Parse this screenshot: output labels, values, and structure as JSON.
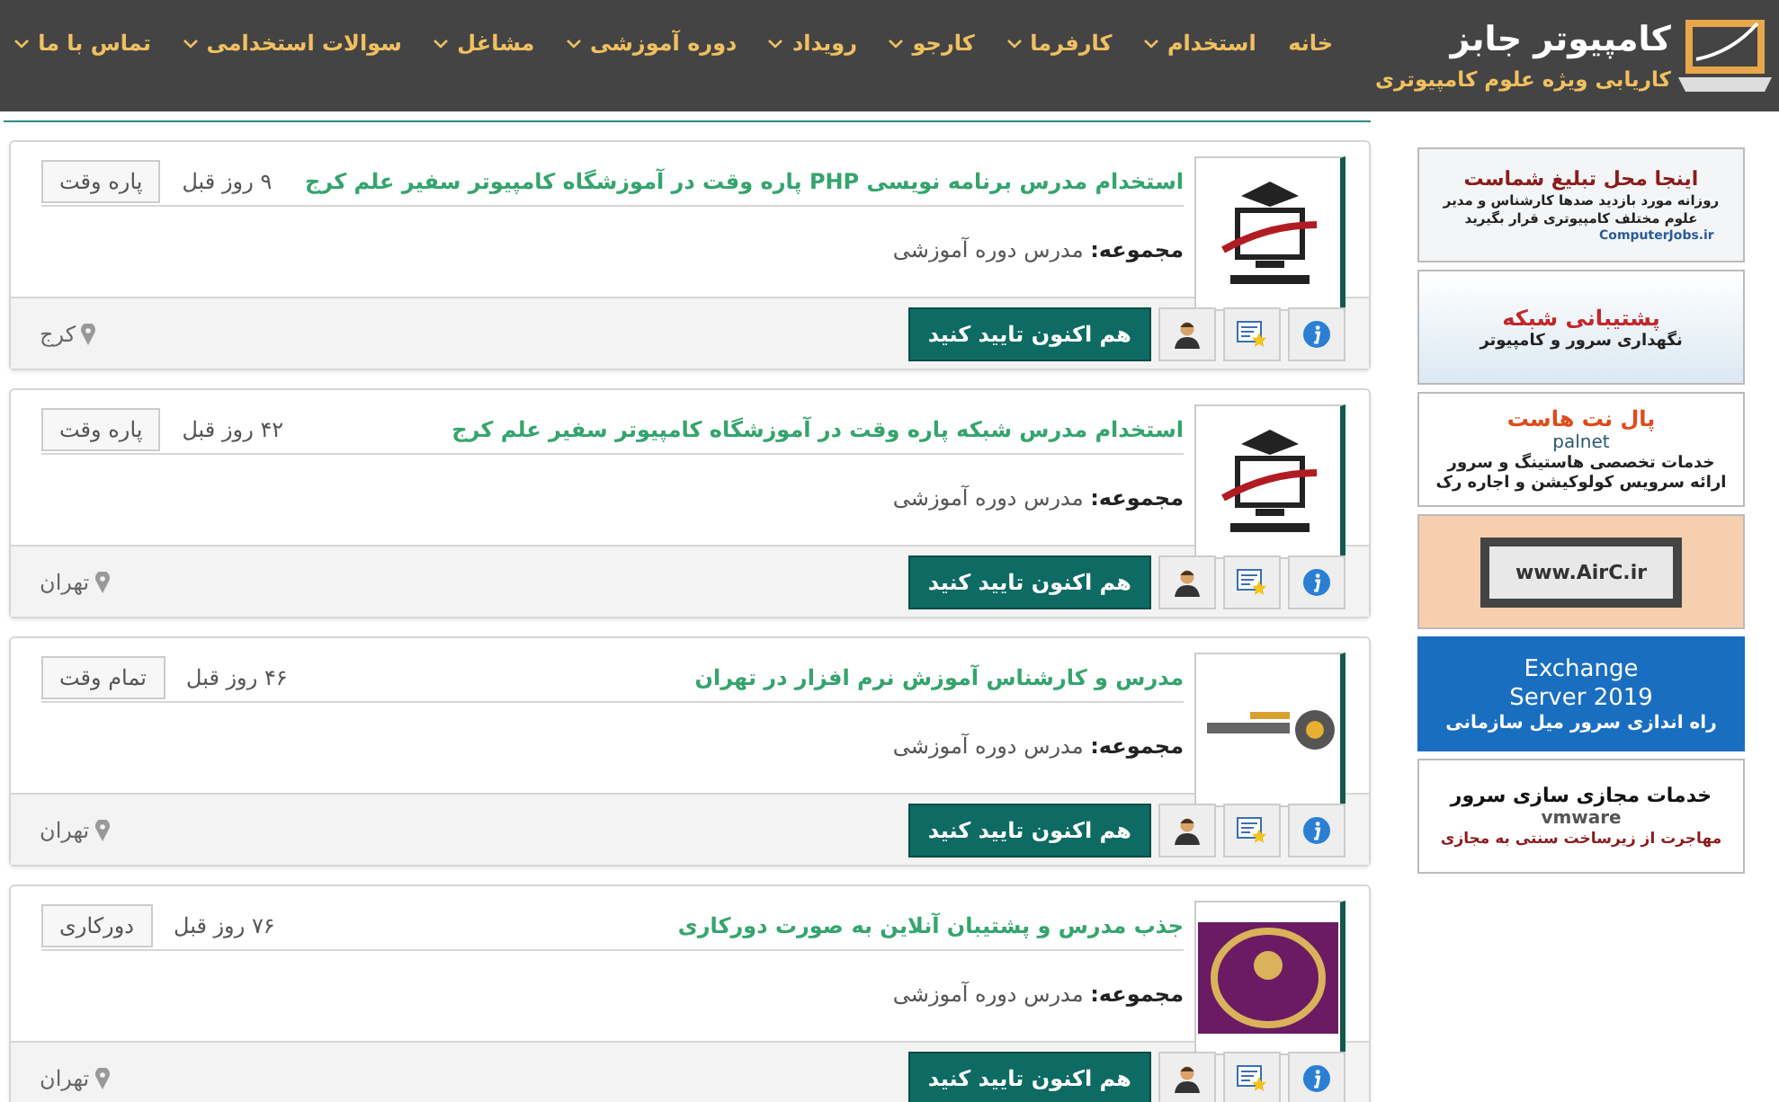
{
  "header": {
    "logo_title": "کامپیوتر جابز",
    "logo_subtitle": "کاریابی ویژه علوم کامپیوتری",
    "nav": [
      {
        "label": "خانه",
        "dropdown": false
      },
      {
        "label": "استخدام",
        "dropdown": true
      },
      {
        "label": "کارفرما",
        "dropdown": true
      },
      {
        "label": "کارجو",
        "dropdown": true
      },
      {
        "label": "رویداد",
        "dropdown": true
      },
      {
        "label": "دوره آموزشی",
        "dropdown": true
      },
      {
        "label": "مشاغل",
        "dropdown": true
      },
      {
        "label": "سوالات استخدامی",
        "dropdown": true
      },
      {
        "label": "تماس با ما",
        "dropdown": true
      }
    ]
  },
  "jobs": [
    {
      "kind": "safir",
      "title": "استخدام مدرس برنامه نویسی PHP پاره وقت در آموزشگاه کامپیوتر سفیر علم کرج",
      "time": "۹ روز قبل",
      "type": "پاره وقت",
      "category": "**مجموعه:** مدرس دوره آموزشی",
      "apply": "هم اکنون تایید کنید",
      "location": "کرج"
    },
    {
      "kind": "safir",
      "title": "استخدام مدرس شبکه پاره وقت در آموزشگاه کامپیوتر سفیر علم کرج",
      "time": "۴۲ روز قبل",
      "type": "پاره وقت",
      "category": "**مجموعه:** مدرس دوره آموزشی",
      "apply": "هم اکنون تایید کنید",
      "location": "تهران"
    },
    {
      "kind": "gear",
      "title": "مدرس و کارشناس آموزش نرم افزار در تهران",
      "time": "۴۶ روز قبل",
      "type": "تمام وقت",
      "category": "**مجموعه:** مدرس دوره آموزشی",
      "apply": "هم اکنون تایید کنید",
      "location": "تهران"
    },
    {
      "kind": "emblem",
      "title": "جذب مدرس و پشتیبان آنلاین به صورت دورکاری",
      "time": "۷۶ روز قبل",
      "type": "دورکاری",
      "category": "**مجموعه:** مدرس دوره آموزشی",
      "apply": "هم اکنون تایید کنید",
      "location": "تهران"
    }
  ],
  "ads": [
    {
      "kind": "billboard",
      "lines": [
        "اینجا محل تبلیغ شماست",
        "روزانه مورد بازدید صدها کارشناس و مدیر",
        "علوم مختلف کامپیوتری قرار بگیرید",
        "ComputerJobs.ir"
      ]
    },
    {
      "kind": "network",
      "lines": [
        "پشتیبانی شبکه",
        "نگهداری سرور و کامپیوتر"
      ]
    },
    {
      "kind": "hosting",
      "lines": [
        "پال نت هاست",
        "palnet",
        "خدمات تخصصی هاستینگ و سرور",
        "ارائه سرویس کولوکیشن و اجاره رک"
      ]
    },
    {
      "kind": "laptop",
      "lines": [
        "www.AirC.ir"
      ]
    },
    {
      "kind": "exchange",
      "lines": [
        "Exchange",
        "Server 2019",
        "راه اندازی سرور میل سازمانی"
      ]
    },
    {
      "kind": "virtual",
      "lines": [
        "خدمات مجازی سازی سرور",
        "vmware",
        "مهاجرت از زیرساخت سنتی به مجازی"
      ]
    }
  ]
}
